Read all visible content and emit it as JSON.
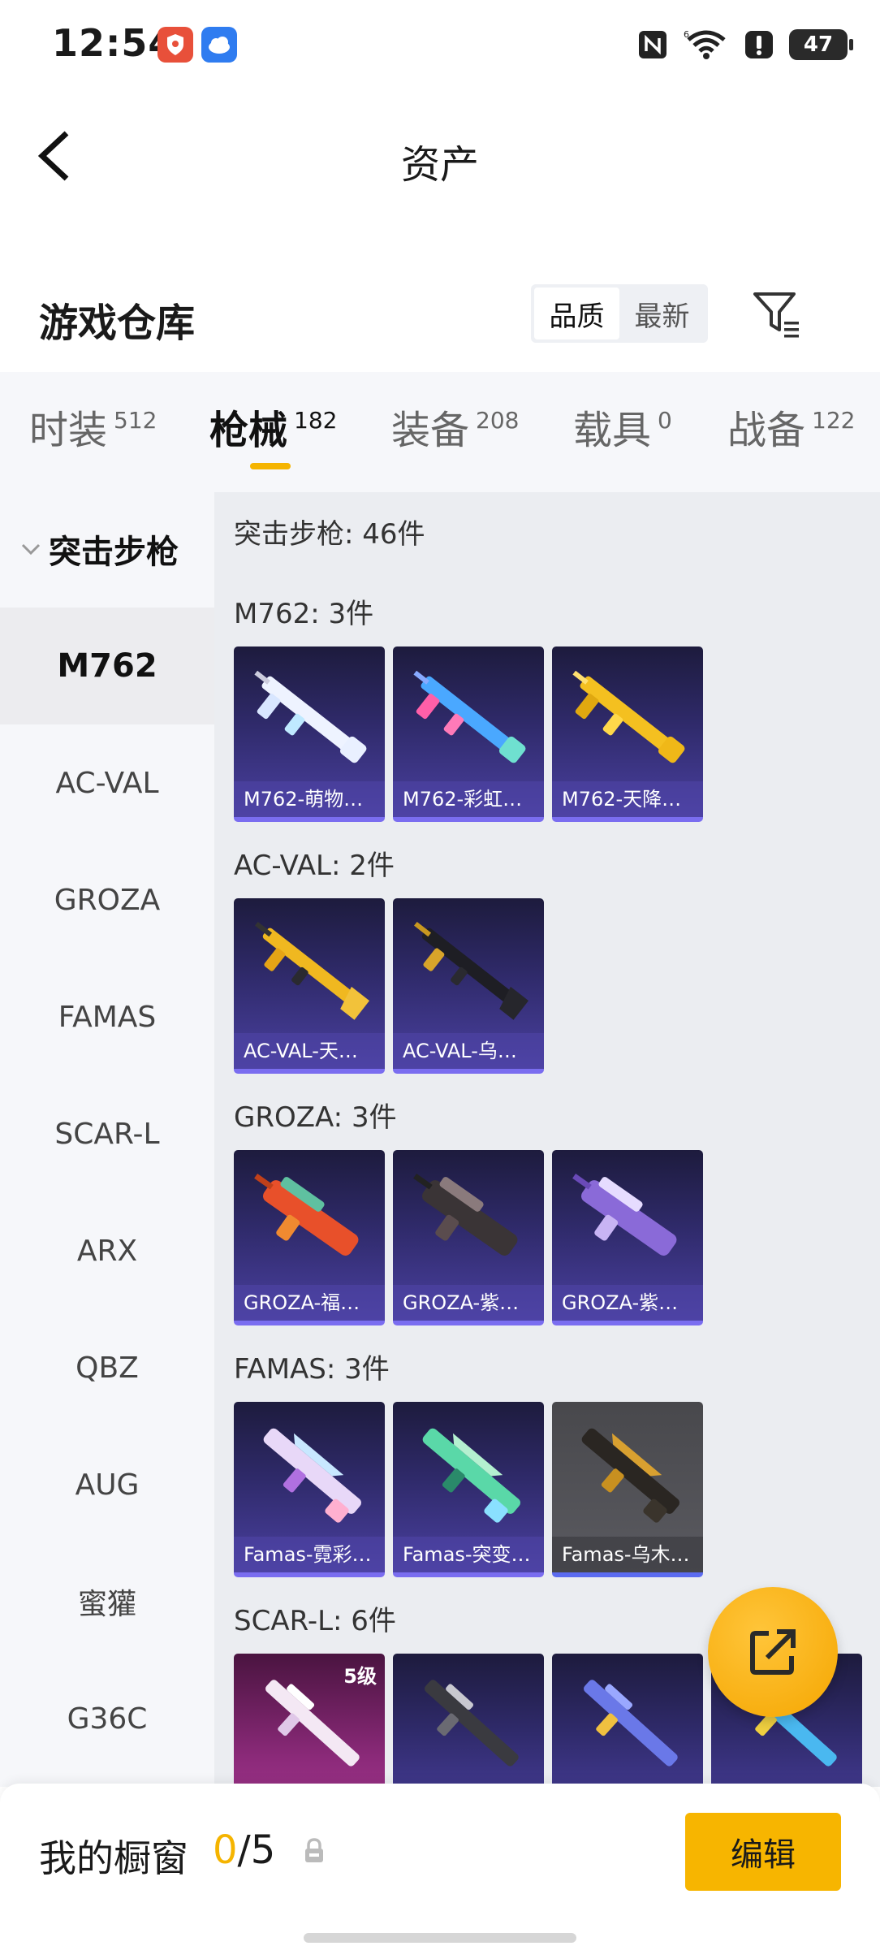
{
  "status_bar": {
    "time": "12:54",
    "battery": "47"
  },
  "header": {
    "title": "资产"
  },
  "warehouse": {
    "title": "游戏仓库",
    "sort_options": [
      "品质",
      "最新"
    ],
    "active_sort": "品质"
  },
  "tabs": [
    {
      "label": "时装",
      "count": "512"
    },
    {
      "label": "枪械",
      "count": "182"
    },
    {
      "label": "装备",
      "count": "208"
    },
    {
      "label": "载具",
      "count": "0"
    },
    {
      "label": "战备",
      "count": "122"
    }
  ],
  "active_tab": "枪械",
  "sidebar": {
    "group_label": "突击步枪",
    "items": [
      "M762",
      "AC-VAL",
      "GROZA",
      "FAMAS",
      "SCAR-L",
      "ARX",
      "QBZ",
      "AUG",
      "蜜獾",
      "G36C"
    ],
    "active_item": "M762"
  },
  "content": {
    "header": "突击步枪: 46件",
    "groups": [
      {
        "title": "M762: 3件",
        "items": [
          "M762-萌物…",
          "M762-彩虹…",
          "M762-天降…"
        ]
      },
      {
        "title": "AC-VAL: 2件",
        "items": [
          "AC-VAL-天…",
          "AC-VAL-乌…"
        ]
      },
      {
        "title": "GROZA: 3件",
        "items": [
          "GROZA-福…",
          "GROZA-紫…",
          "GROZA-紫…"
        ]
      },
      {
        "title": "FAMAS: 3件",
        "items": [
          "Famas-霓彩…",
          "Famas-突变…",
          "Famas-乌木…"
        ]
      },
      {
        "title": "SCAR-L: 6件",
        "level_badge": "5级"
      }
    ]
  },
  "bottom_bar": {
    "showcase_label": "我的橱窗",
    "showcase_used": "0",
    "showcase_total": "/5",
    "edit_label": "编辑"
  }
}
